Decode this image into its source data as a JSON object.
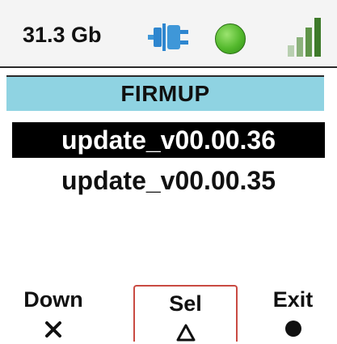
{
  "status": {
    "storage": "31.3 Gb",
    "connection_icon": "usb-plug-icon",
    "status_color": "#4fb52b",
    "signal_icon": "signal-bars-icon"
  },
  "title": "FIRMUP",
  "files": [
    {
      "name": "update_v00.00.36",
      "selected": true
    },
    {
      "name": "update_v00.00.35",
      "selected": false
    }
  ],
  "softkeys": {
    "down": {
      "label": "Down",
      "symbol": "×"
    },
    "sel": {
      "label": "Sel",
      "symbol": "△"
    },
    "exit": {
      "label": "Exit",
      "symbol": "●"
    }
  },
  "colors": {
    "title_bg": "#8fd3e2",
    "selection_bg": "#000000",
    "sel_key_border": "#c94a42"
  }
}
